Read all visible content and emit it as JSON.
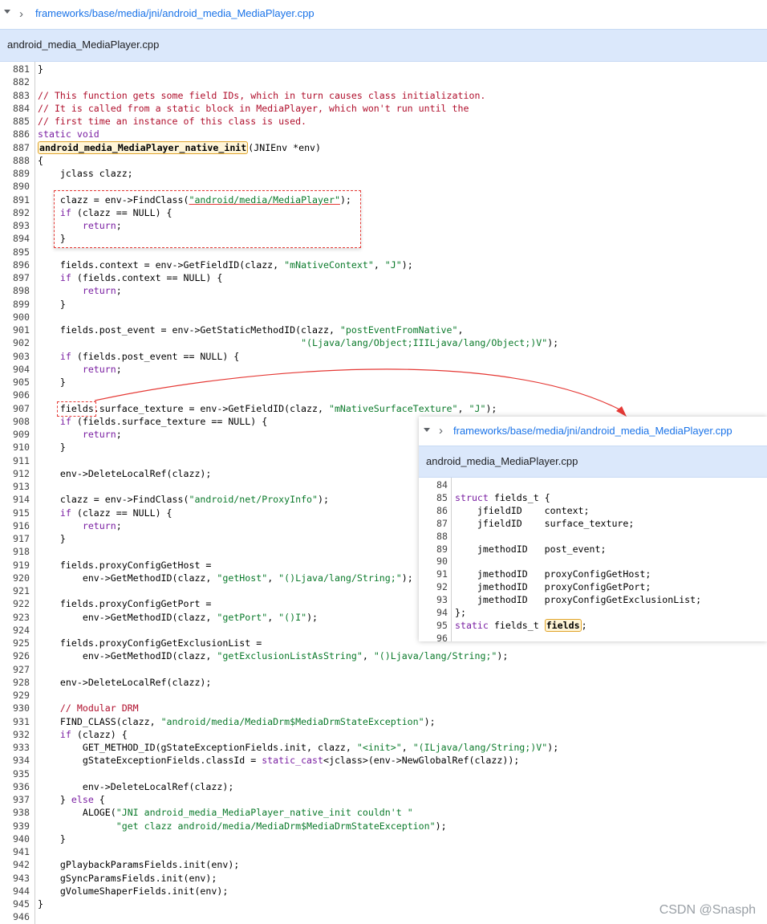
{
  "breadcrumb": {
    "path": "frameworks/base/media/jni/android_media_MediaPlayer.cpp"
  },
  "file_tab": {
    "title": "android_media_MediaPlayer.cpp"
  },
  "colors": {
    "comment": "#b0102d",
    "keyword": "#7a1fa2",
    "string": "#0b7a2b",
    "link": "#1a73e8",
    "annotation": "#e53935",
    "highlight_border": "#e0a42c"
  },
  "code_lines": [
    {
      "n": "881",
      "c": [
        [
          "p",
          "}"
        ]
      ]
    },
    {
      "n": "882",
      "c": []
    },
    {
      "n": "883",
      "c": [
        [
          "cm",
          "// This function gets some field IDs, which in turn causes class initialization."
        ]
      ]
    },
    {
      "n": "884",
      "c": [
        [
          "cm",
          "// It is called from a static block in MediaPlayer, which won't run until the"
        ]
      ]
    },
    {
      "n": "885",
      "c": [
        [
          "cm",
          "// first time an instance of this class is used."
        ]
      ]
    },
    {
      "n": "886",
      "c": [
        [
          "kw",
          "static void"
        ]
      ]
    },
    {
      "n": "887",
      "c": [
        [
          "hl",
          "android_media_MediaPlayer_native_init"
        ],
        [
          "p",
          "(JNIEnv *env)"
        ]
      ]
    },
    {
      "n": "888",
      "c": [
        [
          "p",
          "{"
        ]
      ]
    },
    {
      "n": "889",
      "c": [
        [
          "p",
          "    jclass clazz;"
        ]
      ]
    },
    {
      "n": "890",
      "c": []
    },
    {
      "n": "891",
      "c": [
        [
          "p",
          "    clazz = env->FindClass("
        ],
        [
          "stru",
          "\"android/media/MediaPlayer\""
        ],
        [
          "p",
          ");"
        ]
      ]
    },
    {
      "n": "892",
      "c": [
        [
          "p",
          "    "
        ],
        [
          "kw",
          "if"
        ],
        [
          "p",
          " (clazz == NULL) {"
        ]
      ]
    },
    {
      "n": "893",
      "c": [
        [
          "p",
          "        "
        ],
        [
          "kw",
          "return"
        ],
        [
          "p",
          ";"
        ]
      ]
    },
    {
      "n": "894",
      "c": [
        [
          "p",
          "    }"
        ]
      ]
    },
    {
      "n": "895",
      "c": []
    },
    {
      "n": "896",
      "c": [
        [
          "p",
          "    fields.context = env->GetFieldID(clazz, "
        ],
        [
          "str",
          "\"mNativeContext\""
        ],
        [
          "p",
          ", "
        ],
        [
          "str",
          "\"J\""
        ],
        [
          "p",
          ");"
        ]
      ]
    },
    {
      "n": "897",
      "c": [
        [
          "p",
          "    "
        ],
        [
          "kw",
          "if"
        ],
        [
          "p",
          " (fields.context == NULL) {"
        ]
      ]
    },
    {
      "n": "898",
      "c": [
        [
          "p",
          "        "
        ],
        [
          "kw",
          "return"
        ],
        [
          "p",
          ";"
        ]
      ]
    },
    {
      "n": "899",
      "c": [
        [
          "p",
          "    }"
        ]
      ]
    },
    {
      "n": "900",
      "c": []
    },
    {
      "n": "901",
      "c": [
        [
          "p",
          "    fields.post_event = env->GetStaticMethodID(clazz, "
        ],
        [
          "str",
          "\"postEventFromNative\""
        ],
        [
          "p",
          ","
        ]
      ]
    },
    {
      "n": "902",
      "c": [
        [
          "p",
          "                                               "
        ],
        [
          "str",
          "\"(Ljava/lang/Object;IIILjava/lang/Object;)V\""
        ],
        [
          "p",
          ");"
        ]
      ]
    },
    {
      "n": "903",
      "c": [
        [
          "p",
          "    "
        ],
        [
          "kw",
          "if"
        ],
        [
          "p",
          " (fields.post_event == NULL) {"
        ]
      ]
    },
    {
      "n": "904",
      "c": [
        [
          "p",
          "        "
        ],
        [
          "kw",
          "return"
        ],
        [
          "p",
          ";"
        ]
      ]
    },
    {
      "n": "905",
      "c": [
        [
          "p",
          "    }"
        ]
      ]
    },
    {
      "n": "906",
      "c": []
    },
    {
      "n": "907",
      "c": [
        [
          "p",
          "    fields.surface_texture = env->GetFieldID(clazz, "
        ],
        [
          "str",
          "\"mNativeSurfaceTexture\""
        ],
        [
          "p",
          ", "
        ],
        [
          "str",
          "\"J\""
        ],
        [
          "p",
          ");"
        ]
      ]
    },
    {
      "n": "908",
      "c": [
        [
          "p",
          "    "
        ],
        [
          "kw",
          "if"
        ],
        [
          "p",
          " (fields.surface_texture == NULL) {"
        ]
      ]
    },
    {
      "n": "909",
      "c": [
        [
          "p",
          "        "
        ],
        [
          "kw",
          "return"
        ],
        [
          "p",
          ";"
        ]
      ]
    },
    {
      "n": "910",
      "c": [
        [
          "p",
          "    }"
        ]
      ]
    },
    {
      "n": "911",
      "c": []
    },
    {
      "n": "912",
      "c": [
        [
          "p",
          "    env->DeleteLocalRef(clazz);"
        ]
      ]
    },
    {
      "n": "913",
      "c": []
    },
    {
      "n": "914",
      "c": [
        [
          "p",
          "    clazz = env->FindClass("
        ],
        [
          "str",
          "\"android/net/ProxyInfo\""
        ],
        [
          "p",
          ");"
        ]
      ]
    },
    {
      "n": "915",
      "c": [
        [
          "p",
          "    "
        ],
        [
          "kw",
          "if"
        ],
        [
          "p",
          " (clazz == NULL) {"
        ]
      ]
    },
    {
      "n": "916",
      "c": [
        [
          "p",
          "        "
        ],
        [
          "kw",
          "return"
        ],
        [
          "p",
          ";"
        ]
      ]
    },
    {
      "n": "917",
      "c": [
        [
          "p",
          "    }"
        ]
      ]
    },
    {
      "n": "918",
      "c": []
    },
    {
      "n": "919",
      "c": [
        [
          "p",
          "    fields.proxyConfigGetHost ="
        ]
      ]
    },
    {
      "n": "920",
      "c": [
        [
          "p",
          "        env->GetMethodID(clazz, "
        ],
        [
          "str",
          "\"getHost\""
        ],
        [
          "p",
          ", "
        ],
        [
          "str",
          "\"()Ljava/lang/String;\""
        ],
        [
          "p",
          ");"
        ]
      ]
    },
    {
      "n": "921",
      "c": []
    },
    {
      "n": "922",
      "c": [
        [
          "p",
          "    fields.proxyConfigGetPort ="
        ]
      ]
    },
    {
      "n": "923",
      "c": [
        [
          "p",
          "        env->GetMethodID(clazz, "
        ],
        [
          "str",
          "\"getPort\""
        ],
        [
          "p",
          ", "
        ],
        [
          "str",
          "\"()I\""
        ],
        [
          "p",
          ");"
        ]
      ]
    },
    {
      "n": "924",
      "c": []
    },
    {
      "n": "925",
      "c": [
        [
          "p",
          "    fields.proxyConfigGetExclusionList ="
        ]
      ]
    },
    {
      "n": "926",
      "c": [
        [
          "p",
          "        env->GetMethodID(clazz, "
        ],
        [
          "str",
          "\"getExclusionListAsString\""
        ],
        [
          "p",
          ", "
        ],
        [
          "str",
          "\"()Ljava/lang/String;\""
        ],
        [
          "p",
          ");"
        ]
      ]
    },
    {
      "n": "927",
      "c": []
    },
    {
      "n": "928",
      "c": [
        [
          "p",
          "    env->DeleteLocalRef(clazz);"
        ]
      ]
    },
    {
      "n": "929",
      "c": []
    },
    {
      "n": "930",
      "c": [
        [
          "p",
          "    "
        ],
        [
          "cm",
          "// Modular DRM"
        ]
      ]
    },
    {
      "n": "931",
      "c": [
        [
          "p",
          "    FIND_CLASS(clazz, "
        ],
        [
          "str",
          "\"android/media/MediaDrm$MediaDrmStateException\""
        ],
        [
          "p",
          ");"
        ]
      ]
    },
    {
      "n": "932",
      "c": [
        [
          "p",
          "    "
        ],
        [
          "kw",
          "if"
        ],
        [
          "p",
          " (clazz) {"
        ]
      ]
    },
    {
      "n": "933",
      "c": [
        [
          "p",
          "        GET_METHOD_ID(gStateExceptionFields.init, clazz, "
        ],
        [
          "str",
          "\"<init>\""
        ],
        [
          "p",
          ", "
        ],
        [
          "str",
          "\"(ILjava/lang/String;)V\""
        ],
        [
          "p",
          ");"
        ]
      ]
    },
    {
      "n": "934",
      "c": [
        [
          "p",
          "        gStateExceptionFields.classId = "
        ],
        [
          "kw",
          "static_cast"
        ],
        [
          "p",
          "<jclass>(env->NewGlobalRef(clazz));"
        ]
      ]
    },
    {
      "n": "935",
      "c": []
    },
    {
      "n": "936",
      "c": [
        [
          "p",
          "        env->DeleteLocalRef(clazz);"
        ]
      ]
    },
    {
      "n": "937",
      "c": [
        [
          "p",
          "    } "
        ],
        [
          "kw",
          "else"
        ],
        [
          "p",
          " {"
        ]
      ]
    },
    {
      "n": "938",
      "c": [
        [
          "p",
          "        ALOGE("
        ],
        [
          "str",
          "\"JNI android_media_MediaPlayer_native_init couldn't \""
        ]
      ]
    },
    {
      "n": "939",
      "c": [
        [
          "p",
          "              "
        ],
        [
          "str",
          "\"get clazz android/media/MediaDrm$MediaDrmStateException\""
        ],
        [
          "p",
          ");"
        ]
      ]
    },
    {
      "n": "940",
      "c": [
        [
          "p",
          "    }"
        ]
      ]
    },
    {
      "n": "941",
      "c": []
    },
    {
      "n": "942",
      "c": [
        [
          "p",
          "    gPlaybackParamsFields.init(env);"
        ]
      ]
    },
    {
      "n": "943",
      "c": [
        [
          "p",
          "    gSyncParamsFields.init(env);"
        ]
      ]
    },
    {
      "n": "944",
      "c": [
        [
          "p",
          "    gVolumeShaperFields.init(env);"
        ]
      ]
    },
    {
      "n": "945",
      "c": [
        [
          "p",
          "}"
        ]
      ]
    },
    {
      "n": "946",
      "c": []
    }
  ],
  "inset": {
    "breadcrumb": "frameworks/base/media/jni/android_media_MediaPlayer.cpp",
    "title": "android_media_MediaPlayer.cpp",
    "lines": [
      {
        "n": "84",
        "c": []
      },
      {
        "n": "85",
        "c": [
          [
            "kw",
            "struct"
          ],
          [
            "p",
            " fields_t {"
          ]
        ]
      },
      {
        "n": "86",
        "c": [
          [
            "p",
            "    jfieldID    context;"
          ]
        ]
      },
      {
        "n": "87",
        "c": [
          [
            "p",
            "    jfieldID    surface_texture;"
          ]
        ]
      },
      {
        "n": "88",
        "c": []
      },
      {
        "n": "89",
        "c": [
          [
            "p",
            "    jmethodID   post_event;"
          ]
        ]
      },
      {
        "n": "90",
        "c": []
      },
      {
        "n": "91",
        "c": [
          [
            "p",
            "    jmethodID   proxyConfigGetHost;"
          ]
        ]
      },
      {
        "n": "92",
        "c": [
          [
            "p",
            "    jmethodID   proxyConfigGetPort;"
          ]
        ]
      },
      {
        "n": "93",
        "c": [
          [
            "p",
            "    jmethodID   proxyConfigGetExclusionList;"
          ]
        ]
      },
      {
        "n": "94",
        "c": [
          [
            "p",
            "};"
          ]
        ]
      },
      {
        "n": "95",
        "c": [
          [
            "kw",
            "static"
          ],
          [
            "p",
            " fields_t "
          ],
          [
            "hl",
            "fields"
          ],
          [
            "p",
            ";"
          ]
        ]
      },
      {
        "n": "96",
        "c": []
      }
    ]
  },
  "watermark": "CSDN @Snasph"
}
